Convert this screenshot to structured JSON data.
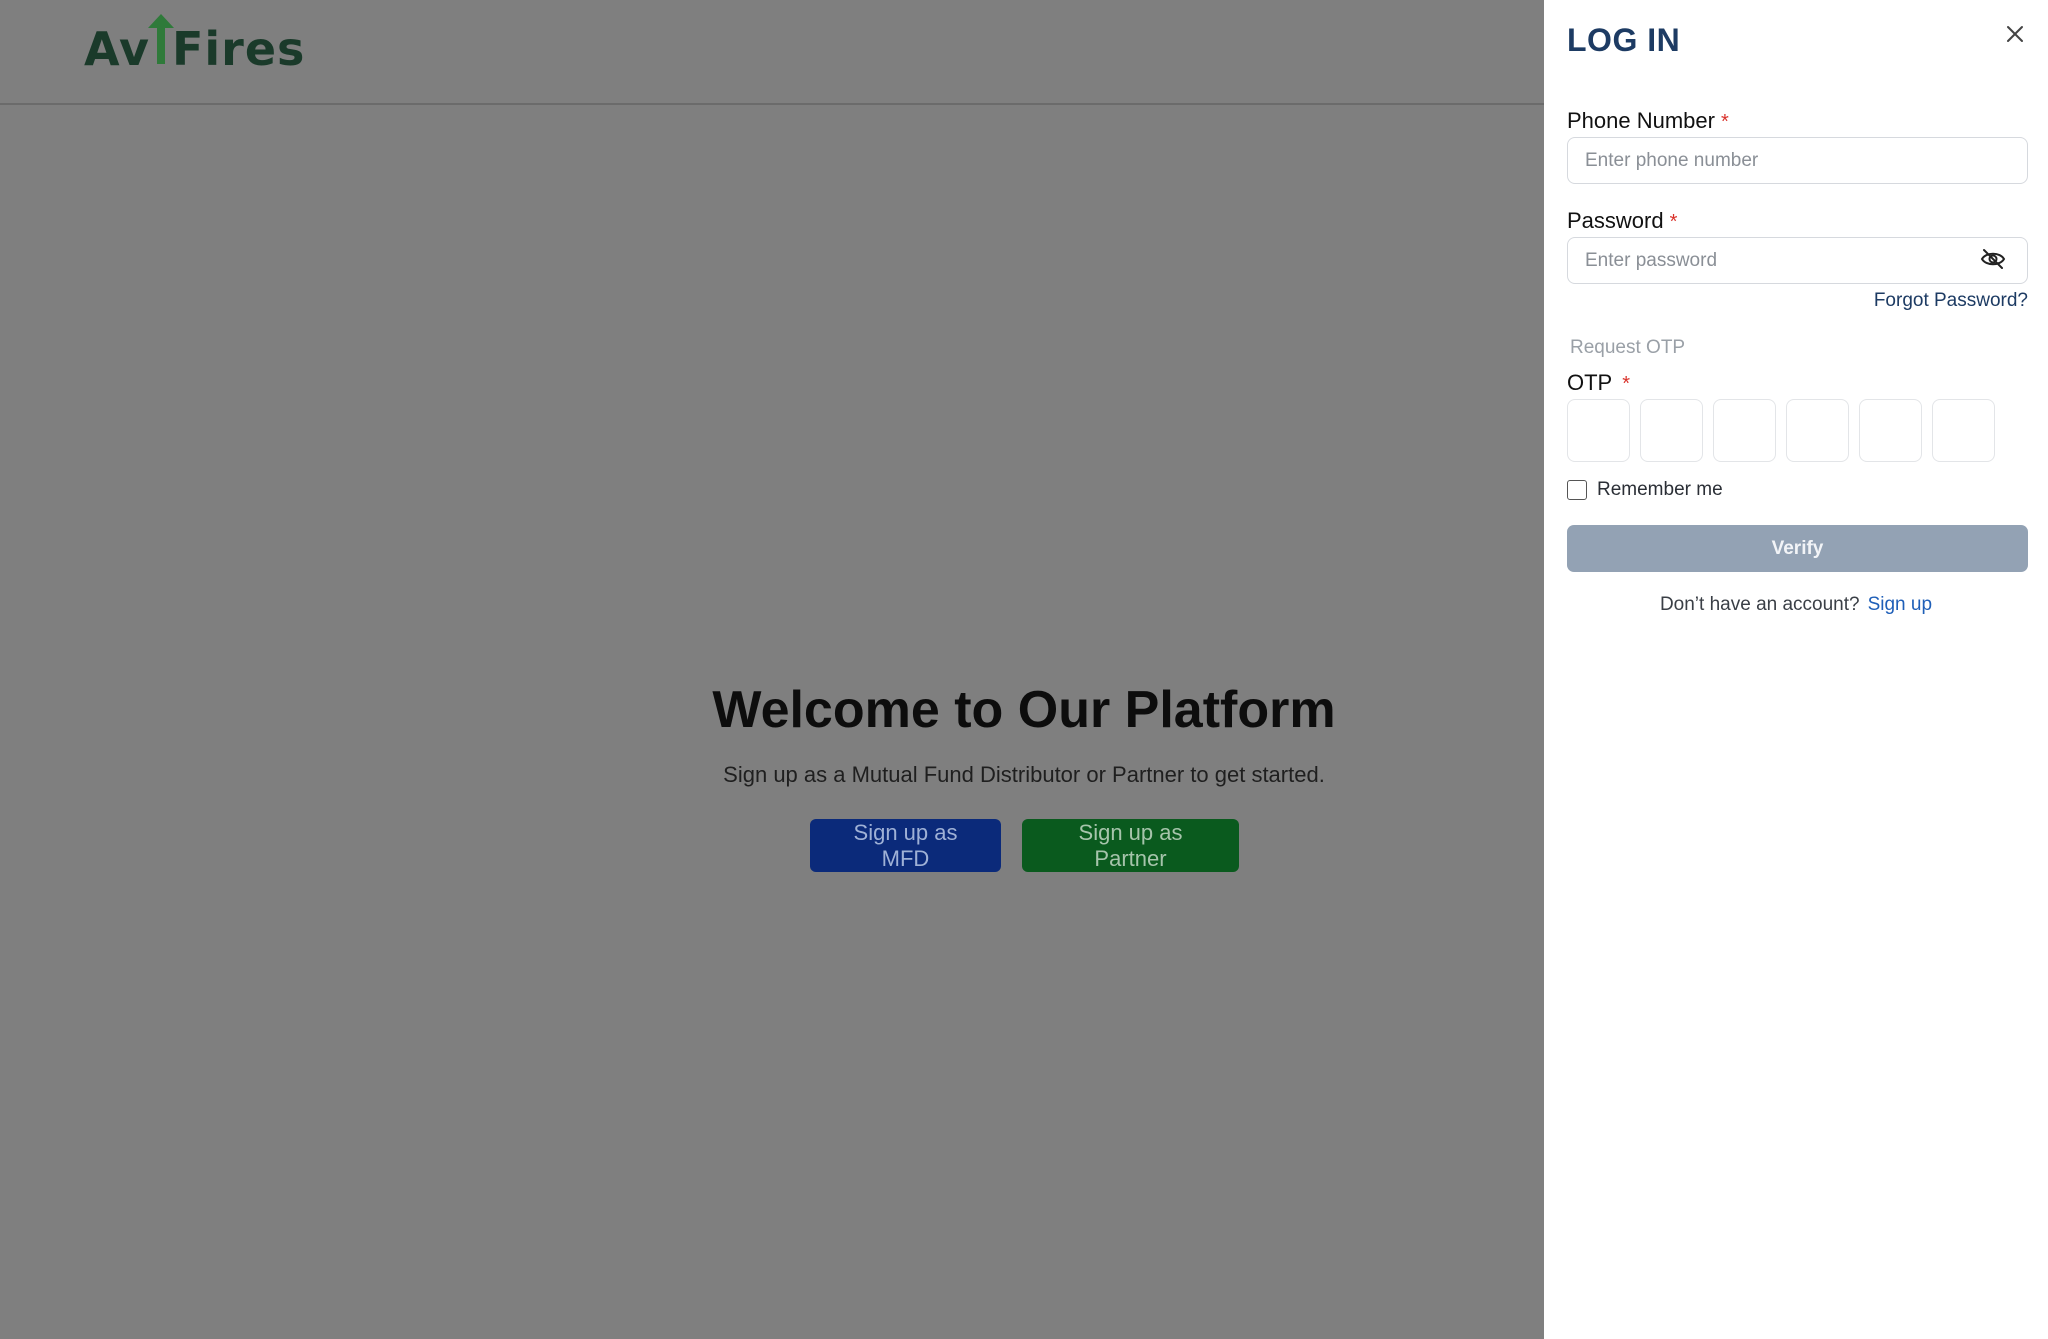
{
  "header": {
    "logo_text_left": "Av",
    "logo_text_right": "Fires"
  },
  "hero": {
    "title": "Welcome to Our Platform",
    "subtitle": "Sign up as a Mutual Fund Distributor or Partner to get started.",
    "mfd_button": "Sign up as MFD",
    "partner_button": "Sign up as Partner"
  },
  "login": {
    "title": "LOG IN",
    "phone_label": "Phone Number",
    "phone_placeholder": "Enter phone number",
    "phone_value": "",
    "password_label": "Password",
    "password_placeholder": "Enter password",
    "password_value": "",
    "required_marker": "*",
    "forgot_password": "Forgot Password?",
    "request_otp": "Request OTP",
    "otp_label": "OTP",
    "otp_digits": [
      "",
      "",
      "",
      "",
      "",
      ""
    ],
    "remember_me": "Remember me",
    "remember_checked": false,
    "verify_button": "Verify",
    "no_account_text": "Don’t have an account?",
    "signup_link": "Sign up"
  },
  "colors": {
    "overlay": "#7f7f7f",
    "title_blue": "#1d3b63",
    "link_blue": "#1f5fb8",
    "verify_disabled": "#93a2b4",
    "mfd_button": "#0b2a7a",
    "partner_button": "#0a5a1e",
    "required_red": "#d9322b",
    "logo_green": "#1a3a2a"
  },
  "icons": {
    "close": "close-icon",
    "password_visibility": "eye-off-icon",
    "logo_arrow": "arrow-up-icon"
  }
}
